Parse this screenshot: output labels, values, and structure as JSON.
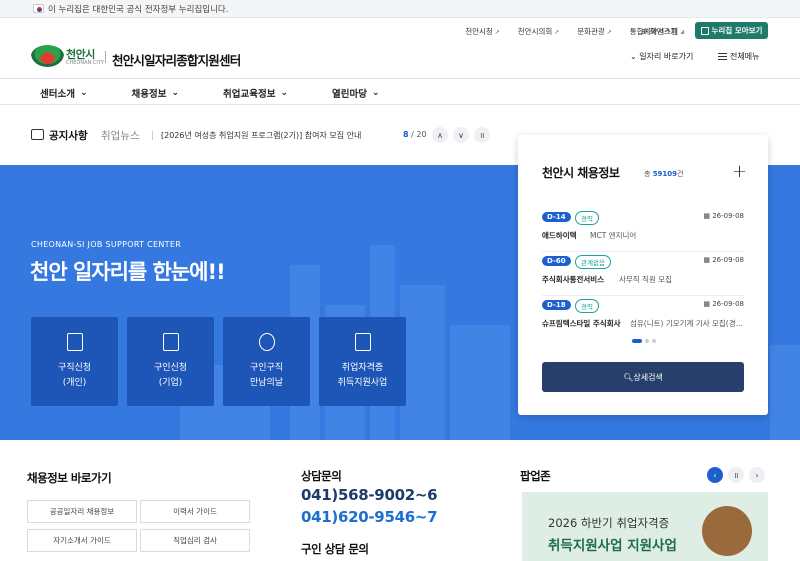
{
  "gov_banner": "이 누리집은 대한민국 공식 전자정부 누리집입니다.",
  "logo": {
    "name": "천안시",
    "sub": "CHEONAN CITY"
  },
  "site_title": "천안시일자리종합지원센터",
  "util_links": [
    "천안시청",
    "천안시의회",
    "문화관광",
    "통합예약시스템"
  ],
  "font_size_label": "화면크기",
  "nuri_button": "누리집 모아보기",
  "quick_go": "일자리 바로가기",
  "all_menu": "전체메뉴",
  "gnb": [
    "센터소개",
    "채용정보",
    "취업교육정보",
    "열린마당"
  ],
  "notice": {
    "tab_active": "공지사항",
    "tab_inactive": "취업뉴스",
    "text": "[2026년 여성층 취업지원 프로그램(2기)] 참여자 모집 안내",
    "page_current": "8",
    "page_total": "/ 20"
  },
  "hero": {
    "subtitle": "CHEONAN-SI JOB SUPPORT CENTER",
    "title": "천안 일자리를 한눈에!!",
    "cards": [
      {
        "icon": "person-doc-icon",
        "label": "구직신청\n(개인)"
      },
      {
        "icon": "building-icon",
        "label": "구인신청\n(기업)"
      },
      {
        "icon": "people-icon",
        "label": "구인구직\n만남의날"
      },
      {
        "icon": "certificate-icon",
        "label": "취업자격증\n취득지원사업"
      }
    ]
  },
  "jobs": {
    "title": "천안시 채용정보",
    "total_prefix": "총",
    "total_count": "59109",
    "total_suffix": "건",
    "items": [
      {
        "dday": "D-14",
        "tag": "경력",
        "date": "26-09-08",
        "company": "애드하이텍",
        "role": "MCT 엔지니어"
      },
      {
        "dday": "D-60",
        "tag": "관계없음",
        "date": "26-09-08",
        "company": "주식회사통전서비스",
        "role": "사무직 직원 모집"
      },
      {
        "dday": "D-18",
        "tag": "경력",
        "date": "26-09-08",
        "company": "슈프림텍스타일 주식회사",
        "role": "섬유(니트) 기모기계 기사 모집(경..."
      }
    ],
    "detail_button": "상세검색"
  },
  "quick_section": {
    "title": "채용정보 바로가기",
    "buttons": [
      "공공일자리 채용정보",
      "이력서 가이드",
      "자기소개서 가이드",
      "직업심리 검사"
    ]
  },
  "consult": {
    "title": "상담문의",
    "tel1": "041)568-9002~6",
    "tel2": "041)620-9546~7",
    "title2": "구인 상담 문의"
  },
  "popup": {
    "title": "팝업존",
    "line1": "2026 하반기 취업자격증",
    "line2": "취득지원사업 지원사업"
  },
  "colors": {
    "hero_blue": "#3578e0",
    "card_navy": "#1d56b7",
    "accent_blue": "#1b5bd6",
    "green": "#1f7a6a"
  }
}
